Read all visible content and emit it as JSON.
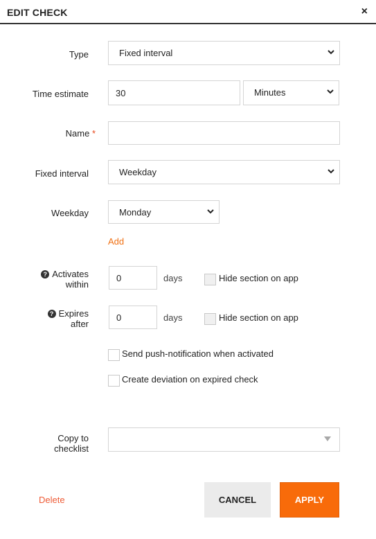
{
  "dialog": {
    "title": "EDIT CHECK",
    "close_symbol": "×"
  },
  "form": {
    "type": {
      "label": "Type",
      "value": "Fixed interval"
    },
    "time_estimate": {
      "label": "Time estimate",
      "value": "30",
      "unit": "Minutes"
    },
    "name": {
      "label": "Name",
      "required_mark": "*",
      "value": ""
    },
    "fixed_interval": {
      "label": "Fixed interval",
      "value": "Weekday"
    },
    "weekday": {
      "label": "Weekday",
      "value": "Monday",
      "add_label": "Add"
    },
    "activates_within": {
      "label_line1": "Activates",
      "label_line2": "within",
      "value": "0",
      "unit": "days",
      "hide_label": "Hide section on app",
      "hide_checked": false
    },
    "expires_after": {
      "label_line1": "Expires",
      "label_line2": "after",
      "value": "0",
      "unit": "days",
      "hide_label": "Hide section on app",
      "hide_checked": false
    },
    "push_notification": {
      "label": "Send push-notification when activated",
      "checked": false
    },
    "create_deviation": {
      "label": "Create deviation on expired check",
      "checked": false
    },
    "copy_to_checklist": {
      "label_line1": "Copy to",
      "label_line2": "checklist",
      "value": ""
    }
  },
  "footer": {
    "delete_label": "Delete",
    "cancel_label": "CANCEL",
    "apply_label": "APPLY"
  },
  "icons": {
    "help": "?",
    "chevron": "chevron-down-icon",
    "dropdown": "triangle-down-icon"
  },
  "colors": {
    "accent": "#f86b0a",
    "delete": "#ee5a35",
    "required": "#e8471b"
  }
}
